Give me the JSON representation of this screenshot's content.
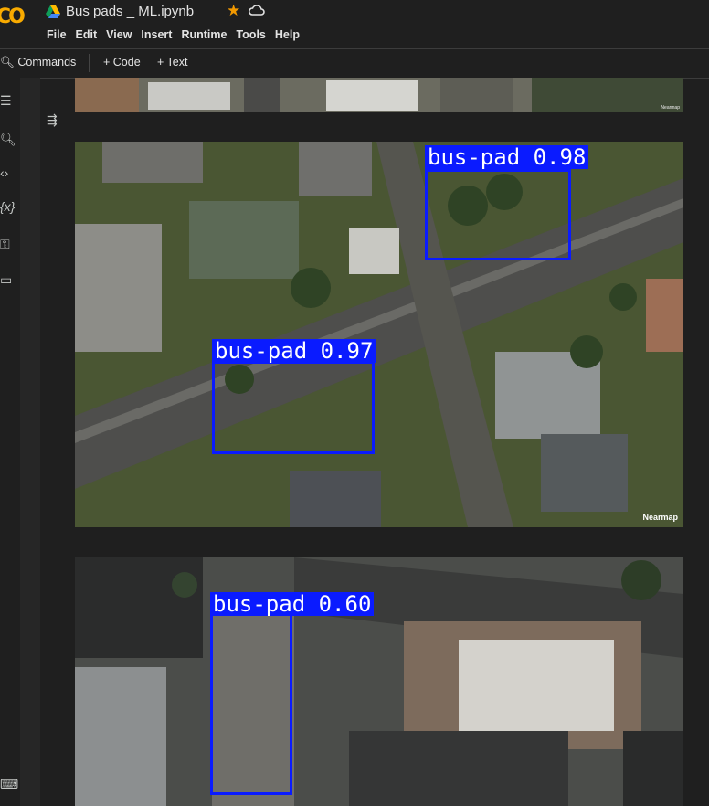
{
  "app": {
    "logo": "CO",
    "notebook_title": "Bus pads _ ML.ipynb"
  },
  "menu": [
    "File",
    "Edit",
    "View",
    "Insert",
    "Runtime",
    "Tools",
    "Help"
  ],
  "toolbar": {
    "commands": "Commands",
    "add_code": "+ Code",
    "add_text": "+ Text"
  },
  "icons": {
    "rail": [
      "menu-icon",
      "search-icon",
      "code-icon",
      "variables-icon",
      "key-icon",
      "folder-icon",
      "terminal-icon"
    ],
    "output": "output-toggle-icon"
  },
  "detections": {
    "image1": [
      {
        "label": "bus-pad 0.98"
      },
      {
        "label": "bus-pad 0.97"
      }
    ],
    "image2": [
      {
        "label": "bus-pad 0.60"
      }
    ]
  },
  "watermark": "Nearmap",
  "colors": {
    "box": "#0a1bff",
    "accent_star": "#f29900",
    "logo": "#f9ab00"
  }
}
